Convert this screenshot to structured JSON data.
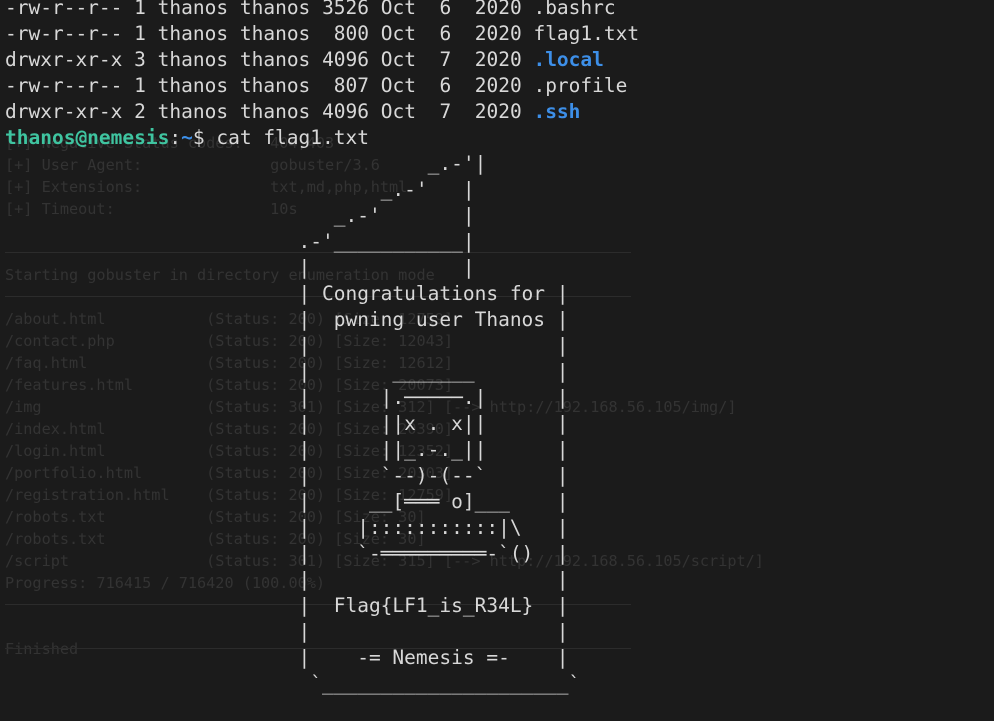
{
  "ghost": {
    "lines": [
      "",
      "",
      "",
      "",
      "",
      "",
      "[+] Negative Status codes:   404,403",
      "[+] User Agent:              gobuster/3.6",
      "[+] Extensions:              txt,md,php,html",
      "[+] Timeout:                 10s",
      "",
      "",
      "Starting gobuster in directory enumeration mode",
      "",
      "/about.html           (Status: 200) [Size: 12759]",
      "/contact.php          (Status: 200) [Size: 12043]",
      "/faq.html             (Status: 200) [Size: 12612]",
      "/features.html        (Status: 200) [Size: 20073]",
      "/img                  (Status: 301) [Size: 312] [--> http://192.168.56.105/img/]",
      "/index.html           (Status: 200) [Size: 20390]",
      "/login.html           (Status: 200) [Size: 12352]",
      "/portfolio.html       (Status: 200) [Size: 20303]",
      "/registration.html    (Status: 200) [Size: 12759]",
      "/robots.txt           (Status: 200) [Size: 30]",
      "/robots.txt           (Status: 200) [Size: 30]",
      "/script               (Status: 301) [Size: 315] [--> http://192.168.56.105/script/]",
      "Progress: 716415 / 716420 (100.00%)",
      "",
      "",
      "Finished"
    ]
  },
  "terminal": {
    "listing": [
      {
        "perms": "-rw-r--r--",
        "links": "1",
        "owner": "thanos",
        "group": "thanos",
        "size": "3526",
        "month": "Oct",
        "day": " 6",
        "year": "2020",
        "name": ".bashrc",
        "type": "file"
      },
      {
        "perms": "-rw-r--r--",
        "links": "1",
        "owner": "thanos",
        "group": "thanos",
        "size": " 800",
        "month": "Oct",
        "day": " 6",
        "year": "2020",
        "name": "flag1.txt",
        "type": "file"
      },
      {
        "perms": "drwxr-xr-x",
        "links": "3",
        "owner": "thanos",
        "group": "thanos",
        "size": "4096",
        "month": "Oct",
        "day": " 7",
        "year": "2020",
        "name": ".local",
        "type": "dir"
      },
      {
        "perms": "-rw-r--r--",
        "links": "1",
        "owner": "thanos",
        "group": "thanos",
        "size": " 807",
        "month": "Oct",
        "day": " 6",
        "year": "2020",
        "name": ".profile",
        "type": "file"
      },
      {
        "perms": "drwxr-xr-x",
        "links": "2",
        "owner": "thanos",
        "group": "thanos",
        "size": "4096",
        "month": "Oct",
        "day": " 7",
        "year": "2020",
        "name": ".ssh",
        "type": "dir"
      }
    ],
    "prompt": {
      "user_host": "thanos@nemesis",
      "sep": ":",
      "path": "~",
      "symbol": "$ ",
      "command": "cat flag1.txt"
    },
    "art_lines": [
      "                                    _.-'|",
      "                                _.-'   |",
      "                            _.-'       |",
      "                         .-'___________|",
      "                         |             |",
      "                         | Congratulations for |",
      "                         |  pwning user Thanos |",
      "                         |                     |",
      "                         |       _______       |",
      "                         |      |.─────.|      |",
      "                         |      ||x . x||      |",
      "                         |      ||_.-._||      |",
      "                         |      `--)-(--`      |",
      "                         |     __[═══ o]___    |",
      "                         |    |:::::::::::|\\   |",
      "                         |    `-═════════-`()  |",
      "                         |                     |",
      "                         |  Flag{LF1_is_R34L}  |",
      "                         |                     |",
      "                         |    -= Nemesis =-    |",
      "                          `_____________________`"
    ]
  }
}
